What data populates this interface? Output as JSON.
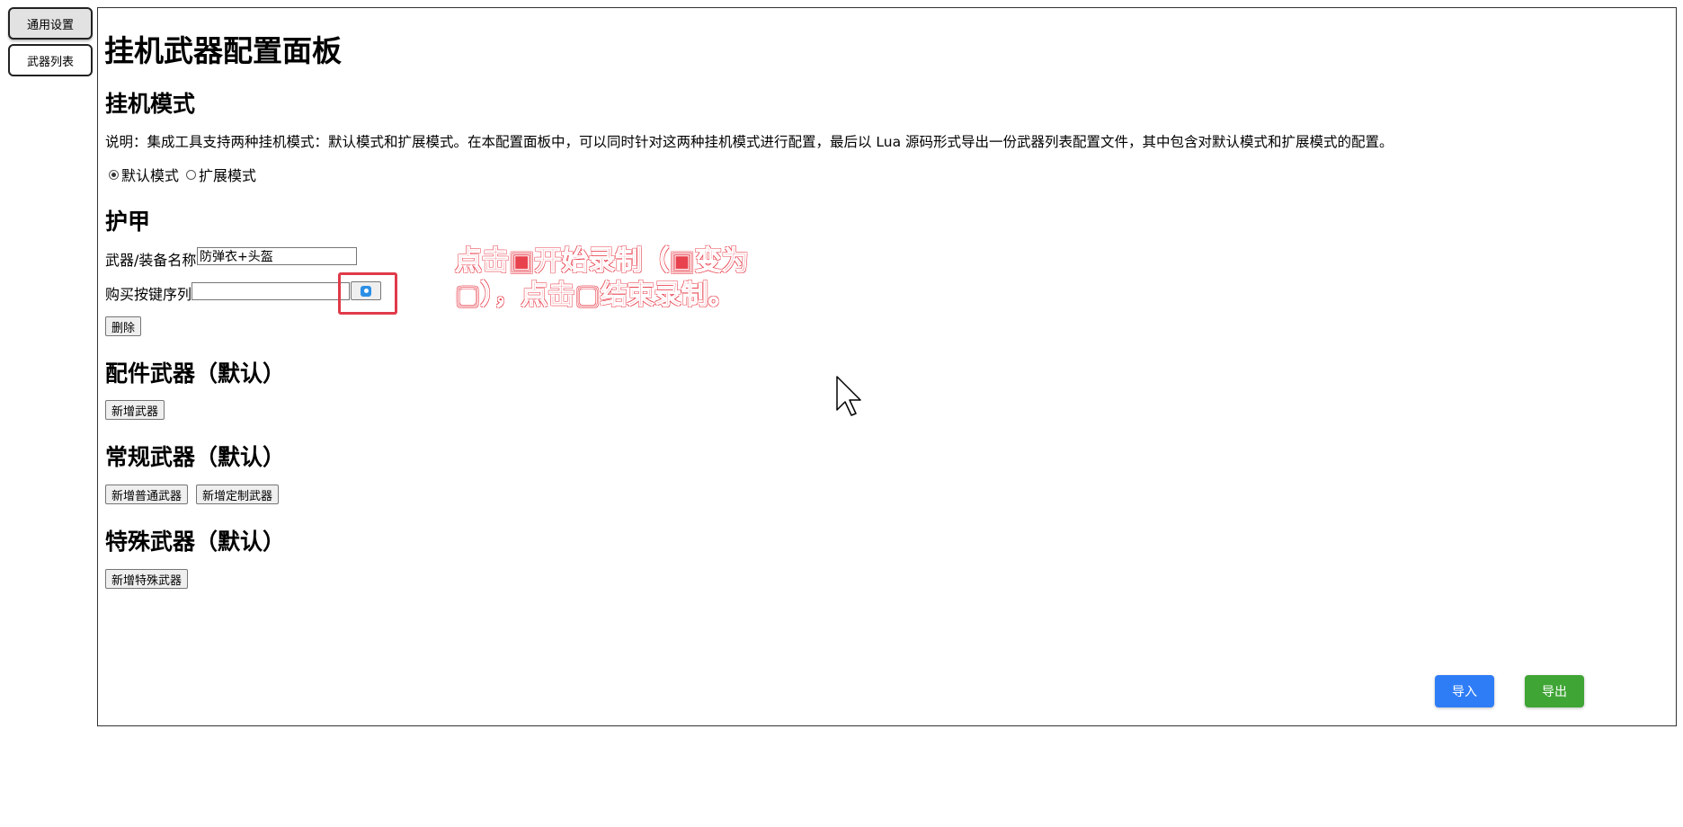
{
  "tabs": [
    {
      "label": "通用设置",
      "active": true
    },
    {
      "label": "武器列表",
      "active": false
    }
  ],
  "panel": {
    "title": "挂机武器配置面板",
    "mode_section": {
      "heading": "挂机模式",
      "description": "说明：集成工具支持两种挂机模式：默认模式和扩展模式。在本配置面板中，可以同时针对这两种挂机模式进行配置，最后以 Lua 源码形式导出一份武器列表配置文件，其中包含对默认模式和扩展模式的配置。",
      "options": [
        {
          "label": "默认模式",
          "checked": true
        },
        {
          "label": "扩展模式",
          "checked": false
        }
      ]
    },
    "armor_section": {
      "heading": "护甲",
      "name_label": "武器/装备名称",
      "name_value": "防弹衣+头盔",
      "keys_label": "购买按键序列",
      "keys_value": "",
      "delete_label": "删除"
    },
    "attachment_section": {
      "heading": "配件武器（默认）",
      "add_label": "新增武器"
    },
    "regular_section": {
      "heading": "常规武器（默认）",
      "add_normal_label": "新增普通武器",
      "add_custom_label": "新增定制武器"
    },
    "special_section": {
      "heading": "特殊武器（默认）",
      "add_label": "新增特殊武器"
    },
    "import_label": "导入",
    "export_label": "导出"
  },
  "annotation": {
    "line1": "点击▣开始录制（▣变为",
    "line2": "▢），点击▢结束录制。"
  },
  "colors": {
    "import": "#2f7df6",
    "export": "#3fa535",
    "annotation": "#e8424f",
    "record_icon": "#2b8fe6"
  }
}
